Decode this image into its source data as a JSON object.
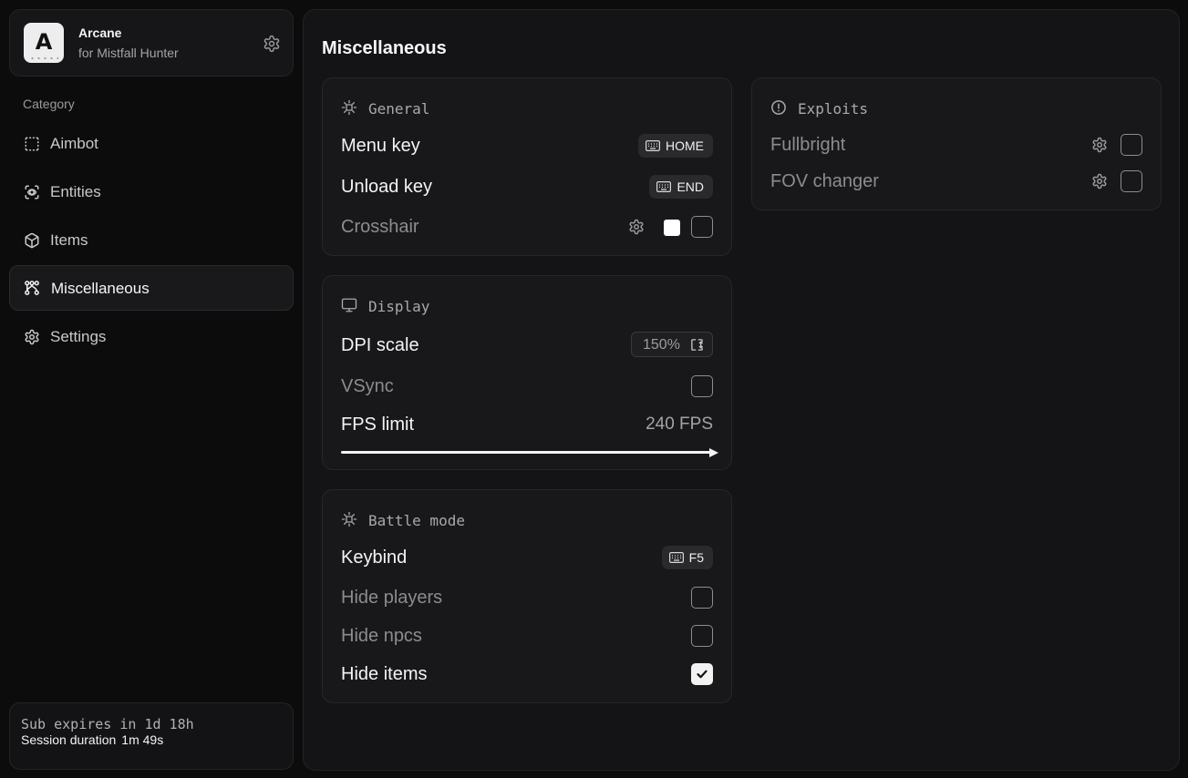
{
  "brand": {
    "logo_letter": "A",
    "name": "Arcane",
    "subtitle": "for Mistfall Hunter"
  },
  "sidebar": {
    "category_label": "Category",
    "items": [
      {
        "label": "Aimbot",
        "icon": "dashed-square-icon",
        "active": false
      },
      {
        "label": "Entities",
        "icon": "scan-target-icon",
        "active": false
      },
      {
        "label": "Items",
        "icon": "cube-icon",
        "active": false
      },
      {
        "label": "Miscellaneous",
        "icon": "nodes-icon",
        "active": true
      },
      {
        "label": "Settings",
        "icon": "gear-icon",
        "active": false
      }
    ],
    "subscription": {
      "expires_text": "Sub expires in 1d 18h",
      "session_label": "Session duration",
      "session_value": "1m 49s"
    }
  },
  "main": {
    "title": "Miscellaneous",
    "general": {
      "title": "General",
      "menu_key": {
        "label": "Menu key",
        "key": "HOME"
      },
      "unload_key": {
        "label": "Unload key",
        "key": "END"
      },
      "crosshair": {
        "label": "Crosshair",
        "color": "#ffffff",
        "enabled": false
      }
    },
    "display": {
      "title": "Display",
      "dpi": {
        "label": "DPI scale",
        "value": "150%"
      },
      "vsync": {
        "label": "VSync",
        "enabled": false
      },
      "fps": {
        "label": "FPS limit",
        "value": "240 FPS",
        "fraction": 1.0
      }
    },
    "battle": {
      "title": "Battle mode",
      "keybind": {
        "label": "Keybind",
        "key": "F5"
      },
      "hide_players": {
        "label": "Hide players",
        "enabled": false
      },
      "hide_npcs": {
        "label": "Hide npcs",
        "enabled": false
      },
      "hide_items": {
        "label": "Hide items",
        "enabled": true
      }
    },
    "exploits": {
      "title": "Exploits",
      "fullbright": {
        "label": "Fullbright",
        "enabled": false
      },
      "fov": {
        "label": "FOV changer",
        "enabled": false
      }
    }
  }
}
